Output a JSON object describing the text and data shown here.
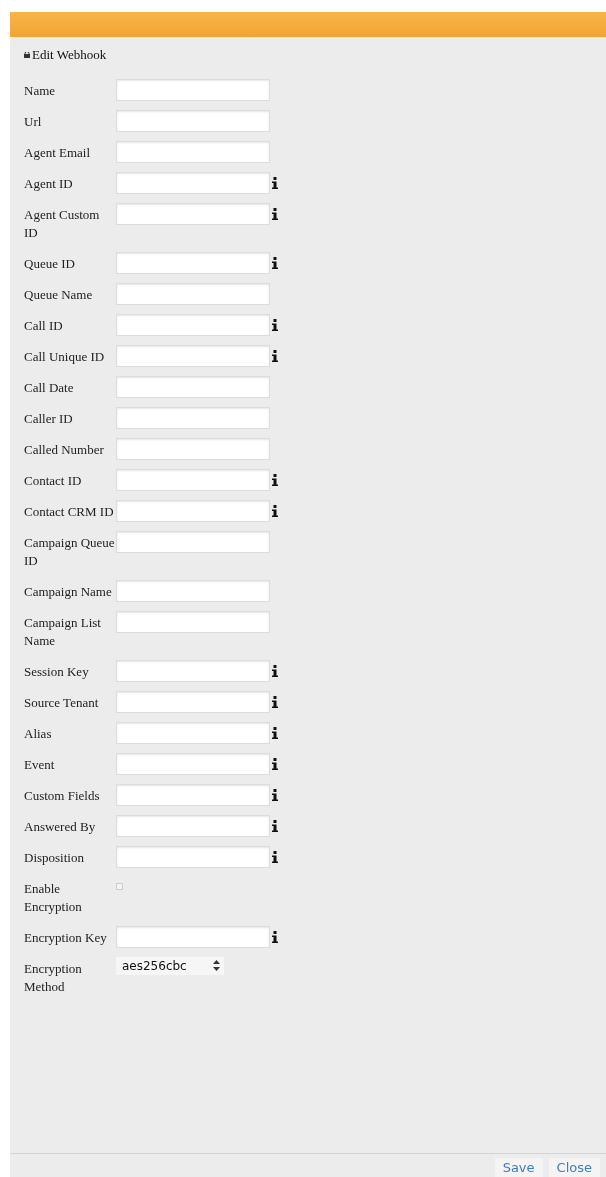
{
  "dialog": {
    "title": "Edit Webhook"
  },
  "fields": [
    {
      "label": "Name",
      "kind": "text",
      "info": false
    },
    {
      "label": "Url",
      "kind": "text",
      "info": false
    },
    {
      "label": "Agent Email",
      "kind": "text",
      "info": false
    },
    {
      "label": "Agent ID",
      "kind": "text",
      "info": true
    },
    {
      "label": "Agent Custom ID",
      "kind": "text",
      "info": true
    },
    {
      "label": "Queue ID",
      "kind": "text",
      "info": true
    },
    {
      "label": "Queue Name",
      "kind": "text",
      "info": false
    },
    {
      "label": "Call ID",
      "kind": "text",
      "info": true
    },
    {
      "label": "Call Unique ID",
      "kind": "text",
      "info": true
    },
    {
      "label": "Call Date",
      "kind": "text",
      "info": false
    },
    {
      "label": "Caller ID",
      "kind": "text",
      "info": false
    },
    {
      "label": "Called Number",
      "kind": "text",
      "info": false
    },
    {
      "label": "Contact ID",
      "kind": "text",
      "info": true
    },
    {
      "label": "Contact CRM ID",
      "kind": "text",
      "info": true
    },
    {
      "label": "Campaign Queue ID",
      "kind": "text",
      "info": false
    },
    {
      "label": "Campaign Name",
      "kind": "text",
      "info": false
    },
    {
      "label": "Campaign List Name",
      "kind": "text",
      "info": false
    },
    {
      "label": "Session Key",
      "kind": "text",
      "info": true
    },
    {
      "label": "Source Tenant",
      "kind": "text",
      "info": true
    },
    {
      "label": "Alias",
      "kind": "text",
      "info": true
    },
    {
      "label": "Event",
      "kind": "text",
      "info": true
    },
    {
      "label": "Custom Fields",
      "kind": "text",
      "info": true
    },
    {
      "label": "Answered By",
      "kind": "text",
      "info": true
    },
    {
      "label": "Disposition",
      "kind": "text",
      "info": true
    },
    {
      "label": "Enable Encryption",
      "kind": "checkbox",
      "checked": false
    },
    {
      "label": "Encryption Key",
      "kind": "text",
      "info": true
    },
    {
      "label": "Encryption Method",
      "kind": "select",
      "value": "aes256cbc"
    }
  ],
  "buttons": [
    "Save",
    "Close"
  ]
}
